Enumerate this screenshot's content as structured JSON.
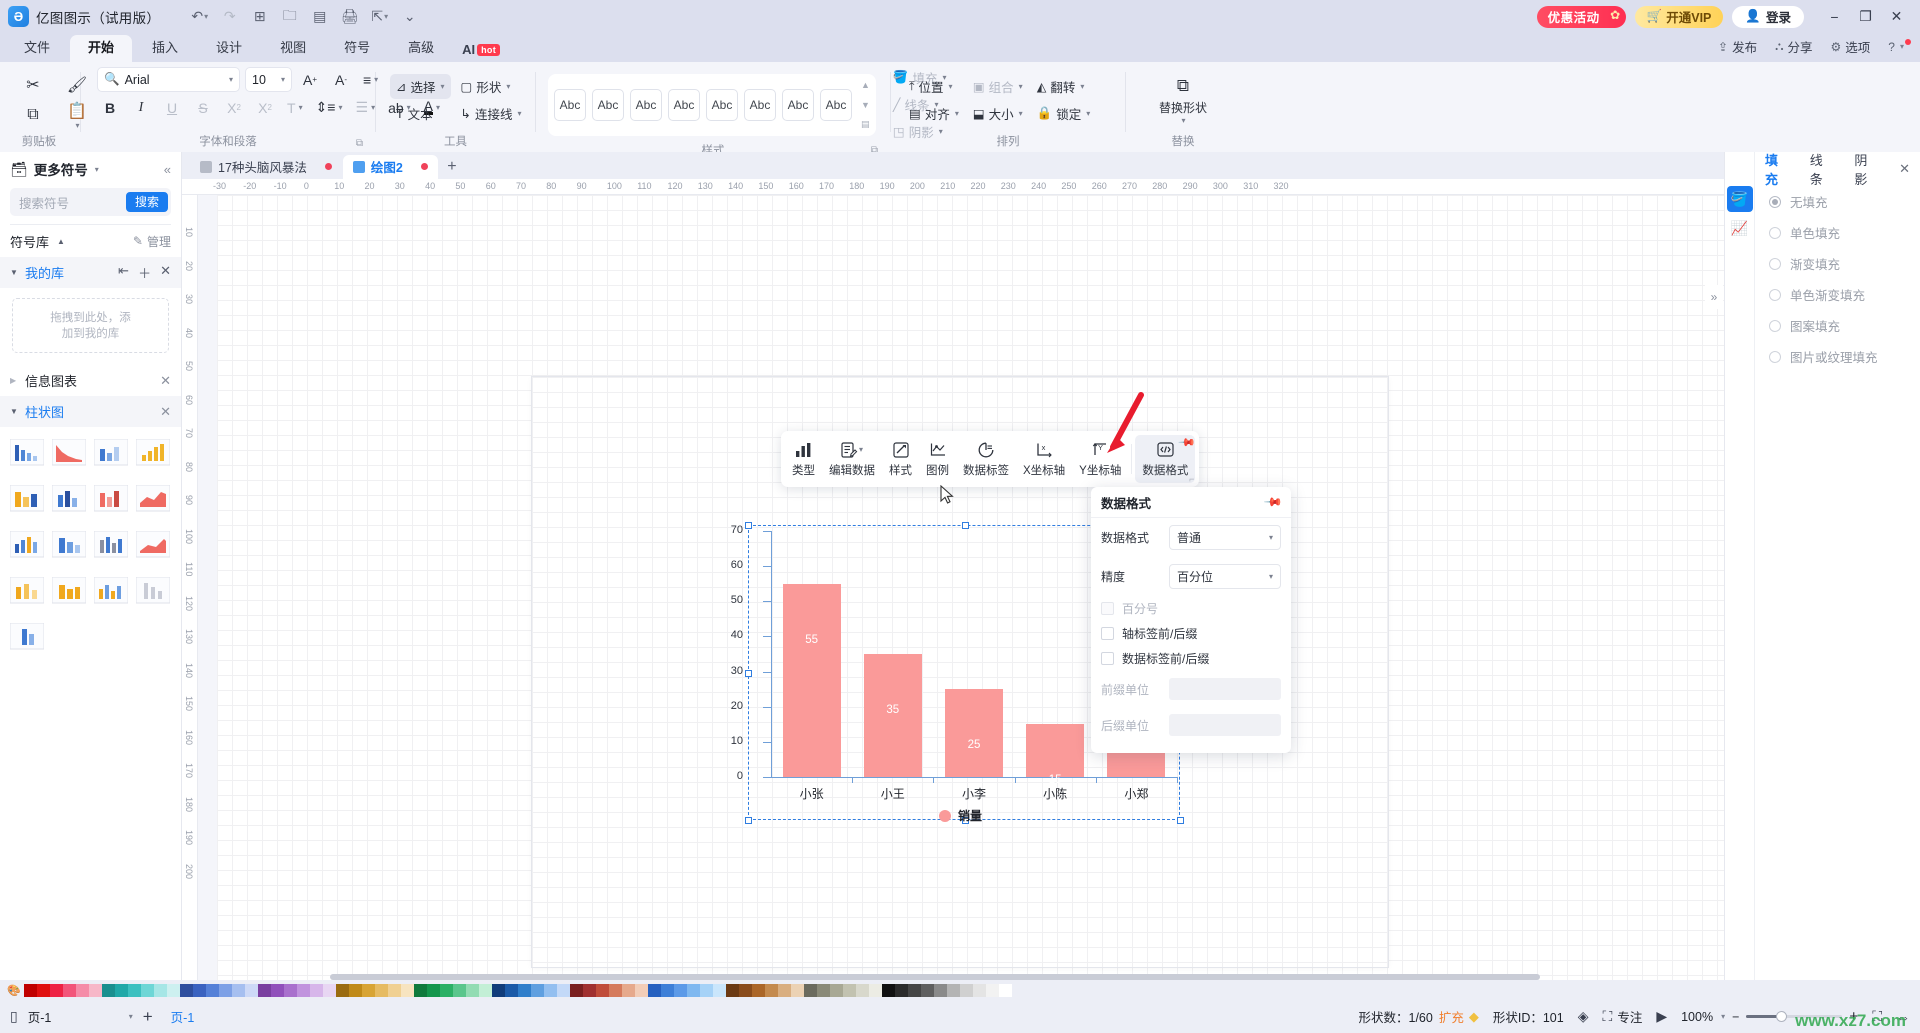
{
  "titlebar": {
    "app_name": "亿图图示（试用版）",
    "logo_glyph": "Ə",
    "quick_icons": [
      "undo-icon",
      "redo-icon",
      "new-icon",
      "open-icon",
      "save-icon",
      "print-icon",
      "export-icon",
      "more-icon"
    ],
    "promo_label": "优惠活动",
    "vip_label": "开通VIP",
    "login_label": "登录",
    "minimize": "−",
    "maximize": "❐",
    "close": "✕"
  },
  "menubar": {
    "tabs": [
      "文件",
      "开始",
      "插入",
      "设计",
      "视图",
      "符号",
      "高级"
    ],
    "active_tab": "开始",
    "ai_label": "AI",
    "ai_hot": "hot",
    "right_items": [
      {
        "label": "发布",
        "icon": "publish-icon"
      },
      {
        "label": "分享",
        "icon": "share-icon"
      },
      {
        "label": "选项",
        "icon": "options-icon"
      },
      {
        "label": "",
        "icon": "help-icon"
      }
    ]
  },
  "ribbon": {
    "groups": [
      {
        "name": "剪贴板",
        "buttons": [
          "剪切",
          "格式刷",
          "复制",
          "粘贴"
        ]
      },
      {
        "name": "字体和段落",
        "font_name": "Arial",
        "font_size": "10",
        "buttons": [
          "加粗",
          "倾斜",
          "下划线",
          "删除线",
          "上标",
          "下标",
          "清除格式",
          "行距",
          "列表",
          "文字方向",
          "字体颜色",
          "增大字号",
          "减小字号",
          "对齐"
        ]
      },
      {
        "name": "工具",
        "buttons": [
          "选择",
          "形状",
          "文本",
          "连接线"
        ]
      },
      {
        "name": "样式",
        "swatch_label": "Abc",
        "swatch_count": 8,
        "side_buttons": [
          "填充",
          "线条",
          "阴影"
        ]
      },
      {
        "name": "排列",
        "buttons": [
          "位置",
          "对齐",
          "组合",
          "大小",
          "翻转",
          "锁定"
        ]
      },
      {
        "name": "替换",
        "buttons": [
          "替换形状"
        ]
      }
    ]
  },
  "left_panel": {
    "header": "更多符号",
    "search_placeholder": "搜索符号",
    "search_button": "搜索",
    "library_label": "符号库",
    "manage_label": "管理",
    "my_library": "我的库",
    "dropzone_line1": "拖拽到此处，添",
    "dropzone_line2": "加到我的库",
    "groups": [
      {
        "label": "信息图表",
        "expanded": false
      },
      {
        "label": "柱状图",
        "expanded": true
      }
    ]
  },
  "canvas": {
    "doc_tabs": [
      {
        "label": "17种头脑风暴法",
        "active": false,
        "modified": true
      },
      {
        "label": "绘图2",
        "active": true,
        "modified": true
      }
    ],
    "add_tab": "+",
    "ruler_h_ticks": [
      "-30",
      "-20",
      "-10",
      "0",
      "10",
      "20",
      "30",
      "40",
      "50",
      "60",
      "70",
      "80",
      "90",
      "100",
      "110",
      "120",
      "130",
      "140",
      "150",
      "160",
      "170",
      "180",
      "190",
      "200",
      "210",
      "220",
      "230",
      "240",
      "250",
      "260",
      "270",
      "280",
      "290",
      "300",
      "310",
      "320"
    ],
    "ruler_v_ticks": [
      "10",
      "20",
      "30",
      "40",
      "50",
      "60",
      "70",
      "80",
      "90",
      "100",
      "110",
      "120",
      "130",
      "140",
      "150",
      "160",
      "170",
      "180",
      "190",
      "200"
    ]
  },
  "chart_data": {
    "type": "bar",
    "title": "",
    "xlabel": "",
    "ylabel": "",
    "categories": [
      "小张",
      "小王",
      "小李",
      "小陈",
      "小郑"
    ],
    "values": [
      55,
      35,
      25,
      15,
      10
    ],
    "value_labels": [
      "55",
      "35",
      "25",
      "15",
      ""
    ],
    "series": [
      {
        "name": "销量",
        "values": [
          55,
          35,
          25,
          15,
          10
        ],
        "color": "#fa9a99"
      }
    ],
    "ylim": [
      0,
      70
    ],
    "yticks": [
      "0",
      "10",
      "20",
      "30",
      "40",
      "50",
      "60",
      "70"
    ],
    "legend": {
      "label": "销量",
      "position": "bottom",
      "marker": "circle",
      "color": "#fa9a99"
    },
    "grid": true
  },
  "chart_toolbar": {
    "items": [
      {
        "label": "类型",
        "icon": "bar-chart-icon",
        "has_caret": false
      },
      {
        "label": "编辑数据",
        "icon": "edit-data-icon",
        "has_caret": true
      },
      {
        "label": "样式",
        "icon": "style-icon",
        "has_caret": false
      },
      {
        "label": "图例",
        "icon": "legend-icon",
        "has_caret": false
      },
      {
        "label": "数据标签",
        "icon": "data-label-icon",
        "has_caret": false
      },
      {
        "label": "X坐标轴",
        "icon": "x-axis-icon",
        "has_caret": false
      },
      {
        "label": "Y坐标轴",
        "icon": "y-axis-icon",
        "has_caret": false
      },
      {
        "label": "数据格式",
        "icon": "data-format-icon",
        "has_caret": false
      }
    ],
    "active_item": "数据格式",
    "pin_icon": "pin-icon"
  },
  "data_format_popup": {
    "title": "数据格式",
    "pin_icon": "pin-icon",
    "rows": [
      {
        "label": "数据格式",
        "value": "普通"
      },
      {
        "label": "精度",
        "value": "百分位"
      }
    ],
    "checkboxes": [
      {
        "label": "百分号",
        "checked": false,
        "disabled": true
      },
      {
        "label": "轴标签前/后缀",
        "checked": false,
        "disabled": false
      },
      {
        "label": "数据标签前/后缀",
        "checked": false,
        "disabled": false
      }
    ],
    "inputs": [
      {
        "label": "前缀单位",
        "value": ""
      },
      {
        "label": "后缀单位",
        "value": ""
      }
    ]
  },
  "right_panel": {
    "tabs": [
      "填充",
      "线条",
      "阴影"
    ],
    "active_tab": "填充",
    "close_icon": "close-icon",
    "collapse_icon": "chevron-right-icon",
    "rail": [
      {
        "icon": "paint-bucket-icon",
        "active": true
      },
      {
        "icon": "chart-icon",
        "active": false
      }
    ],
    "options": [
      {
        "label": "无填充",
        "selected": true
      },
      {
        "label": "单色填充",
        "selected": false
      },
      {
        "label": "渐变填充",
        "selected": false
      },
      {
        "label": "单色渐变填充",
        "selected": false
      },
      {
        "label": "图案填充",
        "selected": false
      },
      {
        "label": "图片或纹理填充",
        "selected": false
      }
    ]
  },
  "statusbar": {
    "page_select": "页-1",
    "add_page": "+",
    "current_page": "页-1",
    "shape_count_label": "形状数：1/60",
    "expand_label": "扩充",
    "shape_id_label": "形状ID：101",
    "focus_label": "专注",
    "zoom_level": "100%",
    "zoom_minus": "−",
    "zoom_plus": "+",
    "watermark": "www.xz7.com"
  },
  "palette": {
    "colors": [
      "#c00000",
      "#e01010",
      "#ee2244",
      "#f2557a",
      "#f58ca8",
      "#f7b7c8",
      "#1a8f8f",
      "#20a8a8",
      "#3cc0c0",
      "#6ed6d6",
      "#a6e6e6",
      "#cdf0f0",
      "#2e4e9e",
      "#3a62c0",
      "#5480d8",
      "#7da0e6",
      "#a6bff0",
      "#cdd9f7",
      "#7a3fa0",
      "#9150bb",
      "#a970cd",
      "#c193de",
      "#d7b6ea",
      "#e8d6f3",
      "#9a6b10",
      "#c08a18",
      "#d8a434",
      "#e6bb62",
      "#f0d092",
      "#f7e4c0",
      "#0f7a3c",
      "#14964c",
      "#2bb065",
      "#5ac68c",
      "#92dcb3",
      "#c3efd6",
      "#103c7a",
      "#1b5aa8",
      "#2f7ecb",
      "#5f9fe0",
      "#93bff0",
      "#c3d9f8",
      "#7a1f1f",
      "#a03030",
      "#c04c3a",
      "#d57a5c",
      "#e6a98c",
      "#f2cdb8",
      "#2560c0",
      "#3d7fd8",
      "#5c9ae8",
      "#7fb8f0",
      "#a6d2f7",
      "#cae6fc",
      "#6b3a14",
      "#8a4c1c",
      "#ab6628",
      "#c48a4e",
      "#d9ae80",
      "#ecd2b4",
      "#6b6b5e",
      "#8a8a78",
      "#a8a894",
      "#c2c2b0",
      "#d8d8cc",
      "#ececE4",
      "#111111",
      "#2b2b2b",
      "#454545",
      "#5f5f5f",
      "#8a8a8a",
      "#b4b4b4",
      "#d0d0d0",
      "#e4e4e4",
      "#f2f2f2",
      "#ffffff"
    ]
  }
}
